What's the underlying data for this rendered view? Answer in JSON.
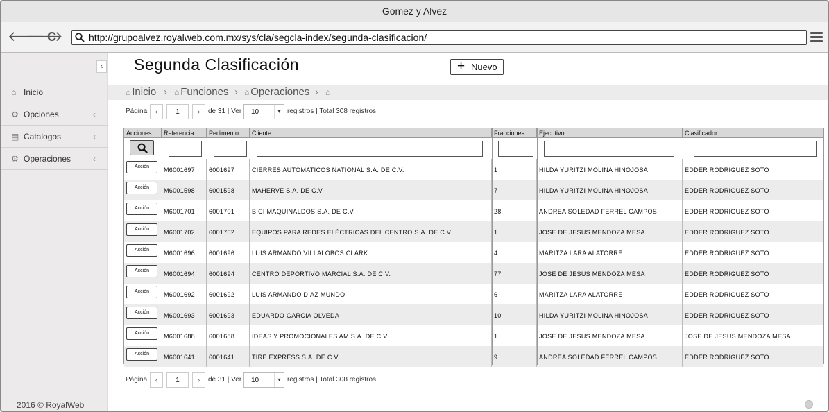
{
  "window": {
    "title": "Gomez y Alvez"
  },
  "browser": {
    "url": "http://grupoalvez.royalweb.com.mx/sys/cla/segcla-index/segunda-clasificacion/",
    "back_glyph": "🡐",
    "forward_glyph": "🡒",
    "reload_glyph": "C"
  },
  "sidebar": {
    "collapse_glyph": "‹",
    "items": [
      {
        "label": "Inicio",
        "icon": "home-icon",
        "glyph": "⌂",
        "chevron": ""
      },
      {
        "label": "Opciones",
        "icon": "cogs-icon",
        "glyph": "⚙",
        "chevron": "‹"
      },
      {
        "label": "Catalogos",
        "icon": "list-icon",
        "glyph": "▤",
        "chevron": "‹"
      },
      {
        "label": "Operaciones",
        "icon": "gear-icon",
        "glyph": "⚙",
        "chevron": "‹"
      }
    ],
    "footer": "2016 © RoyalWeb"
  },
  "page": {
    "title": "Segunda Clasificación",
    "new_button": {
      "plus": "+",
      "label": "Nuevo"
    }
  },
  "breadcrumb": {
    "home_glyph": "⌂",
    "sep": "›",
    "items": [
      "Inicio",
      "Funciones",
      "Operaciones",
      ""
    ]
  },
  "pagination": {
    "label": "Página",
    "prev": "‹",
    "current": "1",
    "next": "›",
    "of_text": "de 31 | Ver",
    "per_page": "10",
    "dropdown_arrow": "▾",
    "summary": "registros | Total 308 registros"
  },
  "table": {
    "columns": [
      "Acciones",
      "Referencia",
      "Pedimento",
      "Cliente",
      "Fracciones",
      "Ejecutivo",
      "Clasificador"
    ],
    "action_label": "Acción",
    "rows": [
      [
        "M6001697",
        "6001697",
        "CIERRES AUTOMATICOS NATIONAL S.A. DE C.V.",
        "1",
        "HILDA YURITZI MOLINA HINOJOSA",
        "EDDER RODRIGUEZ SOTO"
      ],
      [
        "M6001598",
        "6001598",
        "MAHERVE S.A. DE C.V.",
        "7",
        "HILDA YURITZI MOLINA HINOJOSA",
        "EDDER RODRIGUEZ SOTO"
      ],
      [
        "M6001701",
        "6001701",
        "BICI MAQUINALDOS S.A. DE C.V.",
        "28",
        "ANDREA SOLEDAD FERREL CAMPOS",
        "EDDER RODRIGUEZ SOTO"
      ],
      [
        "M6001702",
        "6001702",
        "EQUIPOS PARA REDES ELÉCTRICAS DEL CENTRO S.A. DE C.V.",
        "1",
        "JOSE DE JESUS MENDOZA MESA",
        "EDDER RODRIGUEZ SOTO"
      ],
      [
        "M6001696",
        "6001696",
        "LUIS ARMANDO VILLALOBOS CLARK",
        "4",
        "MARITZA LARA ALATORRE",
        "EDDER RODRIGUEZ SOTO"
      ],
      [
        "M6001694",
        "6001694",
        "CENTRO DEPORTIVO MARCIAL S.A. DE C.V.",
        "77",
        "JOSE DE JESUS MENDOZA MESA",
        "EDDER RODRIGUEZ SOTO"
      ],
      [
        "M6001692",
        "6001692",
        "LUIS ARMANDO DIAZ MUNDO",
        "6",
        "MARITZA LARA ALATORRE",
        "EDDER RODRIGUEZ SOTO"
      ],
      [
        "M6001693",
        "6001693",
        "EDUARDO GARCIA OLVEDA",
        "10",
        "HILDA YURITZI MOLINA HINOJOSA",
        "EDDER RODRIGUEZ SOTO"
      ],
      [
        "M6001688",
        "6001688",
        "IDEAS Y PROMOCIONALES AM S.A. DE C.V.",
        "1",
        "JOSE DE JESUS MENDOZA MESA",
        "JOSE DE JESUS MENDOZA MESA"
      ],
      [
        "M6001641",
        "6001641",
        "TIRE EXPRESS S.A. DE C.V.",
        "9",
        "ANDREA SOLEDAD FERREL CAMPOS",
        "EDDER RODRIGUEZ SOTO"
      ]
    ]
  }
}
